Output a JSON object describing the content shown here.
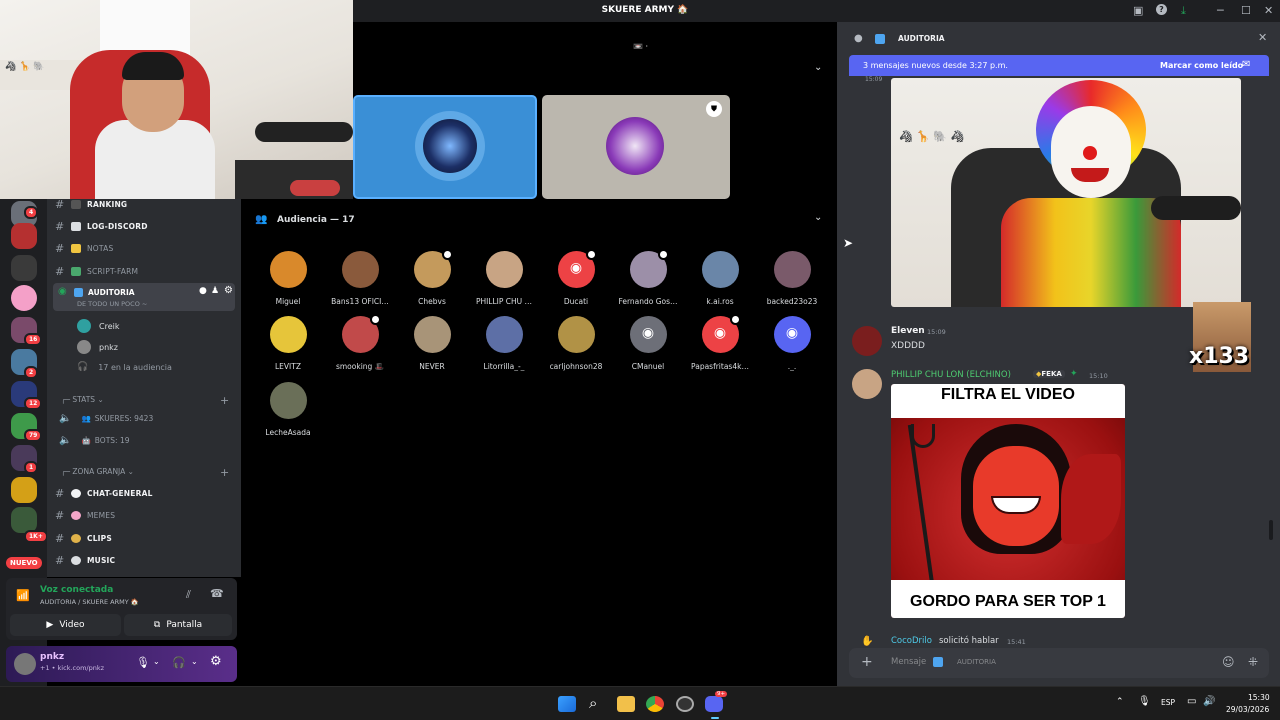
{
  "window": {
    "title": "SKUERE ARMY 🏠"
  },
  "stage": {
    "top_label": "📼 ·",
    "audience_header": "Audiencia — 17"
  },
  "audience": [
    {
      "name": "Miguel",
      "color": "#d9892b"
    },
    {
      "name": "Bans13 OFICI…",
      "color": "#8a5a3c"
    },
    {
      "name": "Chebvs",
      "color": "#c49a5c",
      "mic": true
    },
    {
      "name": "PHILLIP CHU …",
      "color": "#c8a484"
    },
    {
      "name": "Ducati",
      "color": "#ed4245",
      "mic": true,
      "discord": true
    },
    {
      "name": "Fernando Gos…",
      "color": "#9c8fa8",
      "mic": true
    },
    {
      "name": "k.ai.ros",
      "color": "#6a86a8"
    },
    {
      "name": "backed23o23",
      "color": "#7a5a6a"
    },
    {
      "name": "LEVITZ",
      "color": "#e6c53a"
    },
    {
      "name": "smooking 🎩",
      "color": "#c14a4a",
      "mic": true
    },
    {
      "name": "NEVER",
      "color": "#a89478"
    },
    {
      "name": "Litorrilla_-_",
      "color": "#5d6fa6"
    },
    {
      "name": "carljohnson28",
      "color": "#b19246"
    },
    {
      "name": "CManuel",
      "color": "#6d6f78",
      "discord": true
    },
    {
      "name": "Papasfritas4k…",
      "color": "#ed4245",
      "mic": true,
      "discord": true
    },
    {
      "name": "._.",
      "color": "#5865f2",
      "discord": true
    },
    {
      "name": "LecheAsada",
      "color": "#6a6f58"
    }
  ],
  "sidebar": {
    "channels": [
      {
        "label": "RANKING",
        "color": "#ffffff"
      },
      {
        "label": "LOG-DISCORD",
        "color": "#dbdee1"
      },
      {
        "label": "NOTAS",
        "color": "#f0c541"
      },
      {
        "label": "SCRIPT-FARM",
        "color": "#4aa86d"
      }
    ],
    "active_channel": {
      "label": "AUDITORIA",
      "subtitle": "DE TODO UN POCO ~"
    },
    "voice_users": [
      "Creik",
      "pnkz"
    ],
    "audience_count": "17 en la audiencia",
    "cat_stats": "STATS",
    "skueres": "SKUERES: 9423",
    "bots": "BOTS: 19",
    "cat_granja": "ZONA GRANJA",
    "granja_channels": [
      {
        "label": "CHAT-GENERAL",
        "color": "#f2f3f5"
      },
      {
        "label": "MEMES",
        "color": "#f2a6c8"
      },
      {
        "label": "CLIPS",
        "color": "#e0b24a"
      },
      {
        "label": "MUSIC",
        "color": "#dbdee1"
      }
    ]
  },
  "rail": {
    "badges": [
      "4",
      "16",
      "2",
      "12",
      "79",
      "1",
      "1K+"
    ],
    "nuevo": "NUEVO"
  },
  "voice": {
    "status": "Voz conectada",
    "location": "AUDITORIA / SKUERE ARMY 🏠",
    "video_label": "Video",
    "screen_label": "Pantalla"
  },
  "user": {
    "name": "pnkz",
    "status": "+1 • kick.com/pnkz"
  },
  "chat": {
    "channel": "AUDITORIA",
    "new_messages": "3 mensajes nuevos desde 3:27 p.m.",
    "mark_read": "Marcar como leído",
    "first_time": "15:09",
    "messages": [
      {
        "author": "Eleven",
        "time": "15:09",
        "text": "XDDDD"
      },
      {
        "author": "PHILLIP CHU LON (ELCHINO)",
        "tag": "FEKA",
        "time": "15:10"
      }
    ],
    "meme_top": "FILTRA EL VIDEO",
    "meme_bottom": "GORDO PARA SER  TOP 1",
    "partial_author": "CocoDrilo",
    "partial_text": "solicitó hablar",
    "partial_time": "15:41",
    "input_placeholder": "Mensaje",
    "input_channel": "AUDITORIA",
    "overlay": "x133"
  },
  "taskbar": {
    "lang": "ESP",
    "time": "15:30",
    "date": "29/03/2026",
    "discord_badge": "9+"
  }
}
